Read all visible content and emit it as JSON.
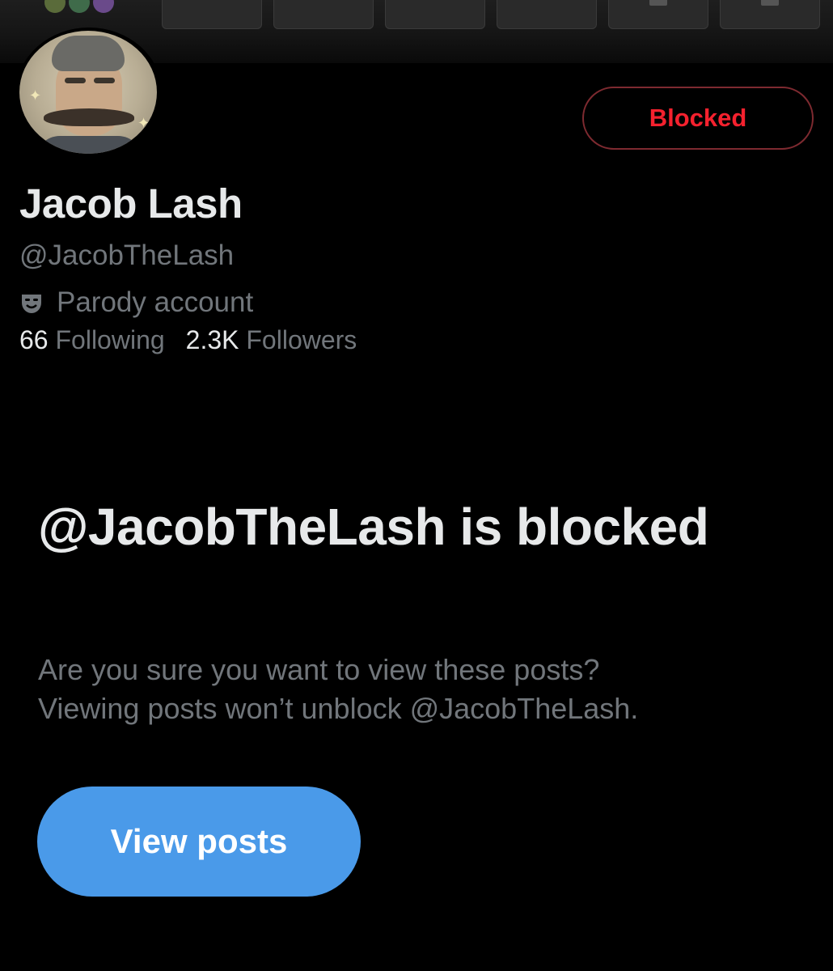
{
  "profile": {
    "name": "Jacob Lash",
    "handle": "@JacobTheLash",
    "label": "Parody account",
    "label_icon": "theater-mask-icon",
    "following_count": "66",
    "following_label": "Following",
    "followers_count": "2.3K",
    "followers_label": "Followers"
  },
  "actions": {
    "blocked_label": "Blocked",
    "view_posts_label": "View posts"
  },
  "blocked_notice": {
    "title": "@JacobTheLash is blocked",
    "line1": "Are you sure you want to view these posts?",
    "line2": "Viewing posts won’t unblock @JacobTheLash."
  },
  "colors": {
    "background": "#000000",
    "blocked_red": "#f4212e",
    "primary_blue": "#4a9ae9",
    "secondary_text": "#71767b",
    "primary_text": "#e7e9ea"
  }
}
